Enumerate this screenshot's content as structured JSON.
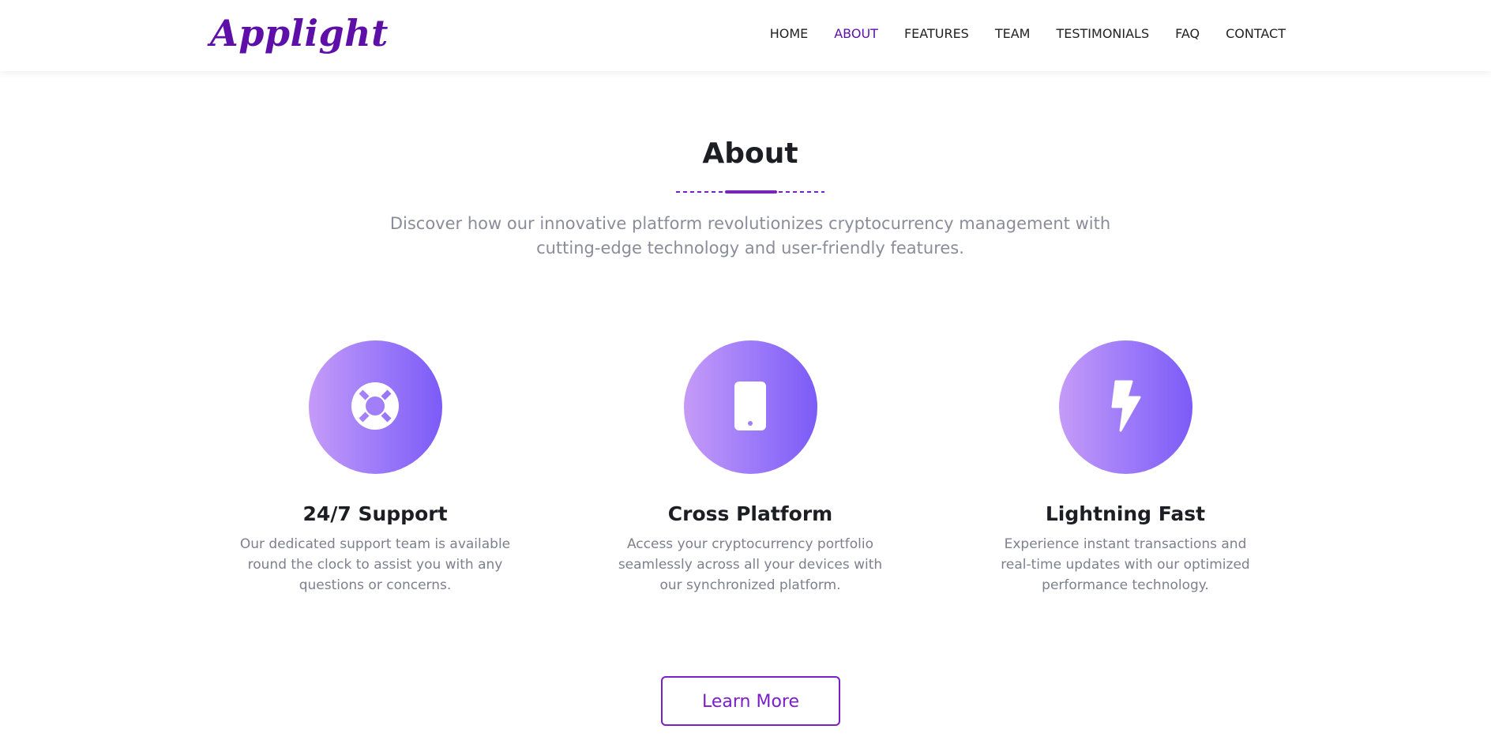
{
  "brand": {
    "logo_text": "Applight",
    "color": "#5e0fa8"
  },
  "nav": {
    "items": [
      {
        "label": "HOME",
        "active": false
      },
      {
        "label": "ABOUT",
        "active": true
      },
      {
        "label": "FEATURES",
        "active": false
      },
      {
        "label": "TEAM",
        "active": false
      },
      {
        "label": "TESTIMONIALS",
        "active": false
      },
      {
        "label": "FAQ",
        "active": false
      },
      {
        "label": "CONTACT",
        "active": false
      }
    ]
  },
  "about": {
    "title": "About",
    "subtitle": "Discover how our innovative platform revolutionizes cryptocurrency management with cutting-edge technology and user-friendly features.",
    "accent_color": "#7a1fc9"
  },
  "features": [
    {
      "icon": "life-ring-icon",
      "title": "24/7 Support",
      "description": "Our dedicated support team is available round the clock to assist you with any questions or concerns."
    },
    {
      "icon": "mobile-phone-icon",
      "title": "Cross Platform",
      "description": "Access your cryptocurrency portfolio seamlessly across all your devices with our synchronized platform."
    },
    {
      "icon": "lightning-bolt-icon",
      "title": "Lightning Fast",
      "description": "Experience instant transactions and real-time updates with our optimized performance technology."
    }
  ],
  "cta": {
    "label": "Learn More"
  },
  "colors": {
    "icon_gradient_start": "#c59bf8",
    "icon_gradient_end": "#7c5bf8",
    "heading": "#1d1d24",
    "body_text": "#8a8d99"
  }
}
